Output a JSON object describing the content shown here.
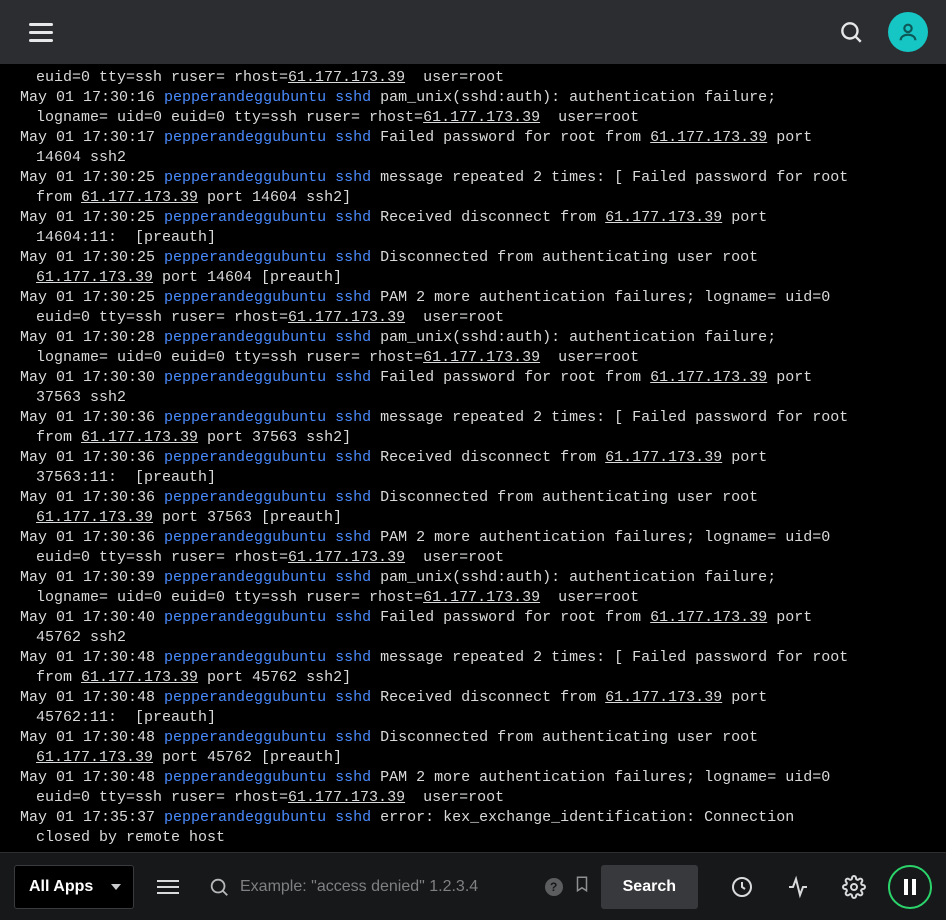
{
  "header": {
    "menu_icon": "hamburger-icon",
    "search_icon": "search-icon",
    "avatar_icon": "user-icon"
  },
  "log": {
    "host": "pepperandeggubuntu",
    "proc": "sshd",
    "ip": "61.177.173.39",
    "lines": [
      {
        "partial": true,
        "cont": "euid=0 tty=ssh ruser= rhost=61.177.173.39  user=root"
      },
      {
        "ts": "May 01 17:30:16",
        "msg": "pam_unix(sshd:auth): authentication failure;",
        "cont": "logname= uid=0 euid=0 tty=ssh ruser= rhost=61.177.173.39  user=root"
      },
      {
        "ts": "May 01 17:30:17",
        "msg": "Failed password for root from 61.177.173.39 port",
        "cont": "14604 ssh2"
      },
      {
        "ts": "May 01 17:30:25",
        "msg": "message repeated 2 times: [ Failed password for root",
        "cont": "from 61.177.173.39 port 14604 ssh2]"
      },
      {
        "ts": "May 01 17:30:25",
        "msg": "Received disconnect from 61.177.173.39 port",
        "cont": "14604:11:  [preauth]"
      },
      {
        "ts": "May 01 17:30:25",
        "msg": "Disconnected from authenticating user root",
        "cont": "61.177.173.39 port 14604 [preauth]"
      },
      {
        "ts": "May 01 17:30:25",
        "msg": "PAM 2 more authentication failures; logname= uid=0",
        "cont": "euid=0 tty=ssh ruser= rhost=61.177.173.39  user=root"
      },
      {
        "ts": "May 01 17:30:28",
        "msg": "pam_unix(sshd:auth): authentication failure;",
        "cont": "logname= uid=0 euid=0 tty=ssh ruser= rhost=61.177.173.39  user=root"
      },
      {
        "ts": "May 01 17:30:30",
        "msg": "Failed password for root from 61.177.173.39 port",
        "cont": "37563 ssh2"
      },
      {
        "ts": "May 01 17:30:36",
        "msg": "message repeated 2 times: [ Failed password for root",
        "cont": "from 61.177.173.39 port 37563 ssh2]"
      },
      {
        "ts": "May 01 17:30:36",
        "msg": "Received disconnect from 61.177.173.39 port",
        "cont": "37563:11:  [preauth]"
      },
      {
        "ts": "May 01 17:30:36",
        "msg": "Disconnected from authenticating user root",
        "cont": "61.177.173.39 port 37563 [preauth]"
      },
      {
        "ts": "May 01 17:30:36",
        "msg": "PAM 2 more authentication failures; logname= uid=0",
        "cont": "euid=0 tty=ssh ruser= rhost=61.177.173.39  user=root"
      },
      {
        "ts": "May 01 17:30:39",
        "msg": "pam_unix(sshd:auth): authentication failure;",
        "cont": "logname= uid=0 euid=0 tty=ssh ruser= rhost=61.177.173.39  user=root"
      },
      {
        "ts": "May 01 17:30:40",
        "msg": "Failed password for root from 61.177.173.39 port",
        "cont": "45762 ssh2"
      },
      {
        "ts": "May 01 17:30:48",
        "msg": "message repeated 2 times: [ Failed password for root",
        "cont": "from 61.177.173.39 port 45762 ssh2]"
      },
      {
        "ts": "May 01 17:30:48",
        "msg": "Received disconnect from 61.177.173.39 port",
        "cont": "45762:11:  [preauth]"
      },
      {
        "ts": "May 01 17:30:48",
        "msg": "Disconnected from authenticating user root",
        "cont": "61.177.173.39 port 45762 [preauth]"
      },
      {
        "ts": "May 01 17:30:48",
        "msg": "PAM 2 more authentication failures; logname= uid=0",
        "cont": "euid=0 tty=ssh ruser= rhost=61.177.173.39  user=root"
      },
      {
        "ts": "May 01 17:35:37",
        "msg": "error: kex_exchange_identification: Connection",
        "cont": "closed by remote host"
      }
    ]
  },
  "bottom": {
    "apps_label": "All Apps",
    "search_placeholder": "Example: \"access denied\" 1.2.3.4",
    "search_button": "Search",
    "help_icon": "?",
    "menu_icon": "hamburger-icon",
    "clock_icon": "clock-icon",
    "activity_icon": "activity-icon",
    "settings_icon": "gear-icon",
    "pause_icon": "pause-icon",
    "bookmark_icon": "bookmark-icon"
  },
  "colors": {
    "topbar_bg": "#2c2d30",
    "accent_teal": "#16c6c4",
    "host_blue": "#4a8cff",
    "pause_ring": "#2bd46b"
  }
}
